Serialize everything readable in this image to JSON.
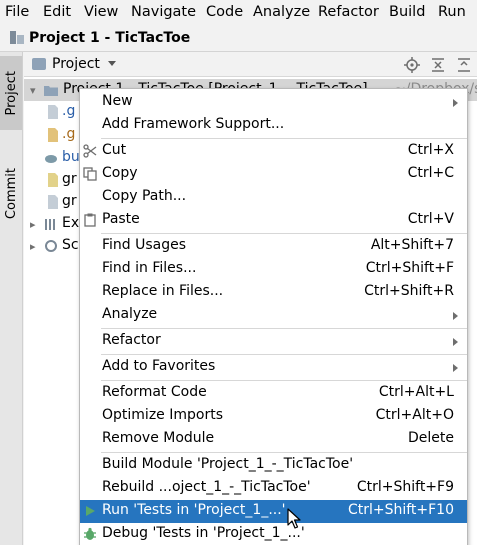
{
  "menubar": {
    "items": [
      "File",
      "Edit",
      "View",
      "Navigate",
      "Code",
      "Analyze",
      "Refactor",
      "Build",
      "Run"
    ]
  },
  "navbar": {
    "title": "Project 1 - TicTacToe"
  },
  "sidebar": {
    "project_tab": "Project",
    "commit_tab": "Commit"
  },
  "panel": {
    "title": "Project"
  },
  "tree": {
    "rows": [
      {
        "label": "Project 1 - TicTacToe [Project_1_-_TicTacToe]",
        "extra": "~/Dropbox/s",
        "icon": "folder-icon"
      },
      {
        "label": ".g",
        "icon": "file-icon"
      },
      {
        "label": ".g",
        "icon": "file-icon"
      },
      {
        "label": "bu",
        "icon": "gradle-icon"
      },
      {
        "label": "gr",
        "icon": "file-icon"
      },
      {
        "label": "gr",
        "icon": "file-icon"
      },
      {
        "label": "Ex",
        "icon": "library-icon"
      },
      {
        "label": "Sc",
        "icon": "scratches-icon"
      }
    ]
  },
  "context_menu": {
    "items": [
      {
        "label": "New",
        "shortcut": "",
        "submenu": true
      },
      {
        "label": "Add Framework Support...",
        "shortcut": "",
        "submenu": false
      },
      {
        "label": "Cut",
        "shortcut": "Ctrl+X",
        "submenu": false,
        "icon": "scissors-icon"
      },
      {
        "label": "Copy",
        "shortcut": "Ctrl+C",
        "submenu": false,
        "icon": "copy-icon"
      },
      {
        "label": "Copy Path...",
        "shortcut": "",
        "submenu": false
      },
      {
        "label": "Paste",
        "shortcut": "Ctrl+V",
        "submenu": false,
        "icon": "paste-icon"
      },
      {
        "label": "Find Usages",
        "shortcut": "Alt+Shift+7",
        "submenu": false
      },
      {
        "label": "Find in Files...",
        "shortcut": "Ctrl+Shift+F",
        "submenu": false
      },
      {
        "label": "Replace in Files...",
        "shortcut": "Ctrl+Shift+R",
        "submenu": false
      },
      {
        "label": "Analyze",
        "shortcut": "",
        "submenu": true
      },
      {
        "label": "Refactor",
        "shortcut": "",
        "submenu": true
      },
      {
        "label": "Add to Favorites",
        "shortcut": "",
        "submenu": true
      },
      {
        "label": "Reformat Code",
        "shortcut": "Ctrl+Alt+L",
        "submenu": false
      },
      {
        "label": "Optimize Imports",
        "shortcut": "Ctrl+Alt+O",
        "submenu": false
      },
      {
        "label": "Remove Module",
        "shortcut": "Delete",
        "submenu": false
      },
      {
        "label": "Build Module 'Project_1_-_TicTacToe'",
        "shortcut": "",
        "submenu": false
      },
      {
        "label": "Rebuild ...oject_1_-_TicTacToe'",
        "shortcut": "Ctrl+Shift+F9",
        "submenu": false
      },
      {
        "label": "Run 'Tests in 'Project_1_...'",
        "shortcut": "Ctrl+Shift+F10",
        "submenu": false,
        "icon": "run-icon",
        "highlighted": true
      },
      {
        "label": "Debug 'Tests in 'Project_1_...'",
        "shortcut": "",
        "submenu": false,
        "icon": "debug-icon"
      }
    ]
  },
  "colors": {
    "highlight": "#2675bf",
    "run_green": "#3d9c4a",
    "folder_blue": "#8ea2b7"
  }
}
